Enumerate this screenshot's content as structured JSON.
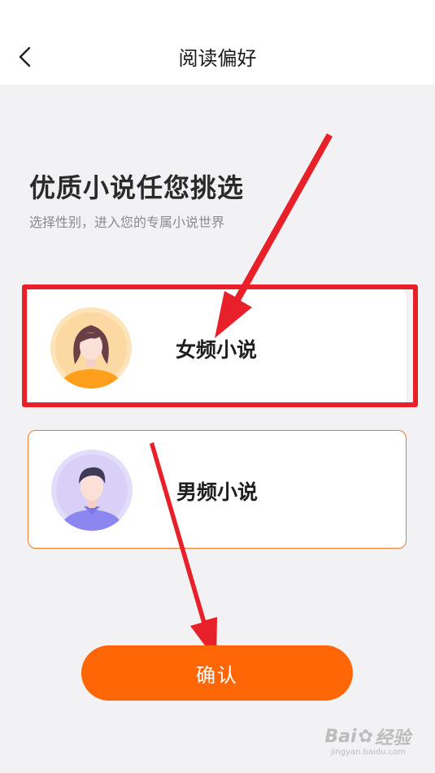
{
  "header": {
    "title": "阅读偏好",
    "back_icon": "chevron-left-icon"
  },
  "intro": {
    "headline": "优质小说任您挑选",
    "subtitle": "选择性别，进入您的专属小说世界"
  },
  "options": [
    {
      "label": "女频小说",
      "icon": "female-avatar-icon",
      "accent": "#ffb33a",
      "selected": false
    },
    {
      "label": "男频小说",
      "icon": "male-avatar-icon",
      "accent": "#8b86f0",
      "selected": true
    }
  ],
  "confirm": {
    "label": "确认",
    "color": "#ff6606"
  },
  "annotation": {
    "highlight_color": "#e8202a",
    "arrow_color": "#e8202a"
  },
  "watermark": {
    "text": "Bai",
    "text2": "经验",
    "sub": "jingyan.baidu.com"
  }
}
